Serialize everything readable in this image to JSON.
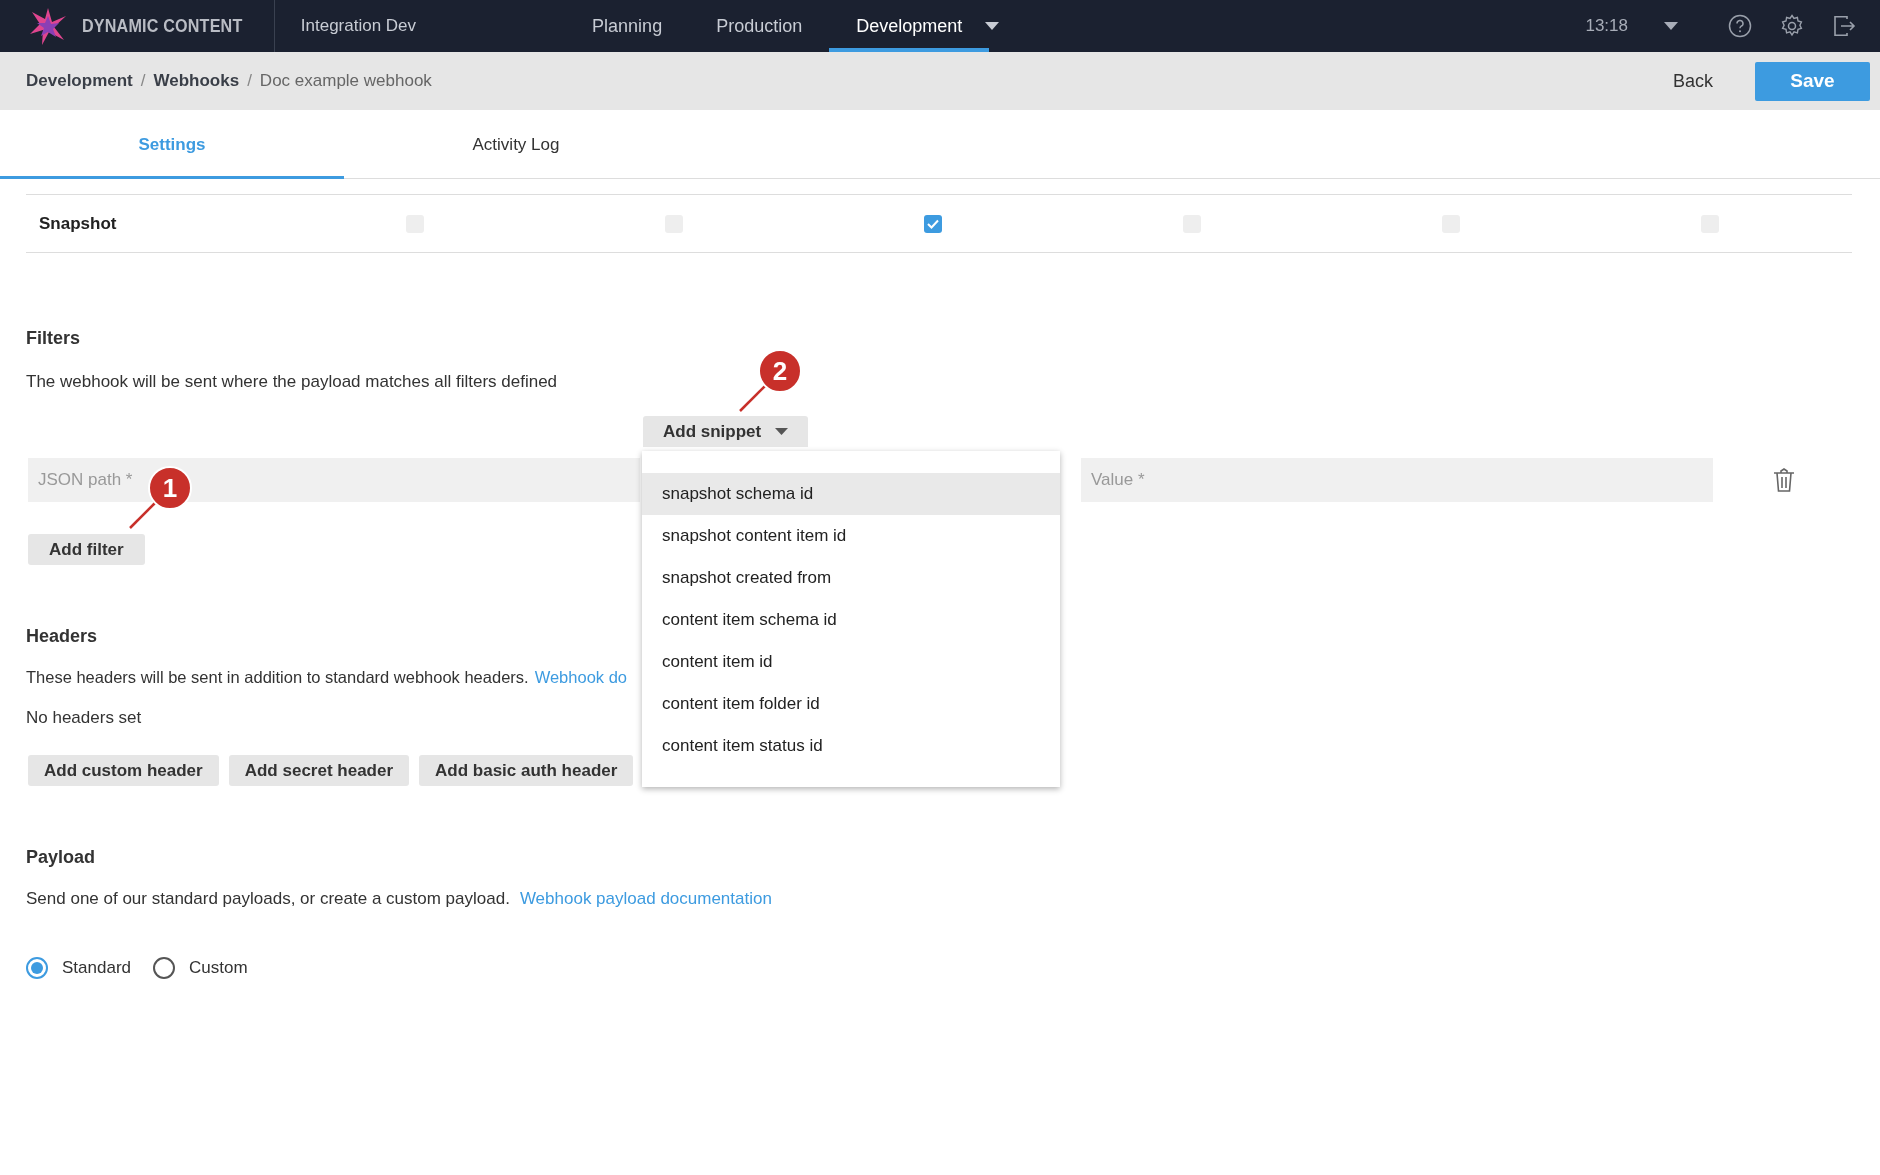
{
  "app": {
    "logo_text": "DYNAMIC CONTENT",
    "hub": "Integration Dev",
    "clock": "13:18"
  },
  "nav": [
    {
      "label": "Planning",
      "selected": false
    },
    {
      "label": "Production",
      "selected": false
    },
    {
      "label": "Development",
      "selected": true
    }
  ],
  "breadcrumb": [
    {
      "label": "Development",
      "kind": "link"
    },
    {
      "label": "Webhooks",
      "kind": "link"
    },
    {
      "label": "Doc example webhook",
      "kind": "current"
    }
  ],
  "breadcrumb_separator": "/",
  "actions": {
    "back": "Back",
    "save": "Save"
  },
  "tabs": [
    {
      "label": "Settings",
      "selected": true
    },
    {
      "label": "Activity Log",
      "selected": false
    }
  ],
  "snapshot_row": {
    "label": "Snapshot",
    "checks": [
      {
        "checked": false
      },
      {
        "checked": false
      },
      {
        "checked": true
      },
      {
        "checked": false
      },
      {
        "checked": false
      },
      {
        "checked": false
      }
    ]
  },
  "filters": {
    "heading": "Filters",
    "description": "The webhook will be sent where the payload matches all filters defined",
    "add_snippet": "Add snippet",
    "json_path": {
      "placeholder": "JSON path *"
    },
    "value": {
      "placeholder": "Value *"
    },
    "add_filter": "Add filter"
  },
  "snippet_menu": [
    {
      "label": "snapshot schema id",
      "selected": true
    },
    {
      "label": "snapshot content item id",
      "selected": false
    },
    {
      "label": "snapshot created from",
      "selected": false
    },
    {
      "label": "content item schema id",
      "selected": false
    },
    {
      "label": "content item id",
      "selected": false
    },
    {
      "label": "content item folder id",
      "selected": false
    },
    {
      "label": "content item status id",
      "selected": false
    }
  ],
  "headers": {
    "heading": "Headers",
    "description": "These headers will be sent in addition to standard webhook headers.",
    "link": "Webhook do",
    "empty": "No headers set",
    "buttons": [
      "Add custom header",
      "Add secret header",
      "Add basic auth header"
    ]
  },
  "payload": {
    "heading": "Payload",
    "description": "Send one of our standard payloads, or create a custom payload.",
    "link": "Webhook payload documentation",
    "options": [
      {
        "label": "Standard",
        "selected": true
      },
      {
        "label": "Custom",
        "selected": false
      }
    ]
  },
  "annotations": [
    {
      "label": "1"
    },
    {
      "label": "2"
    }
  ]
}
